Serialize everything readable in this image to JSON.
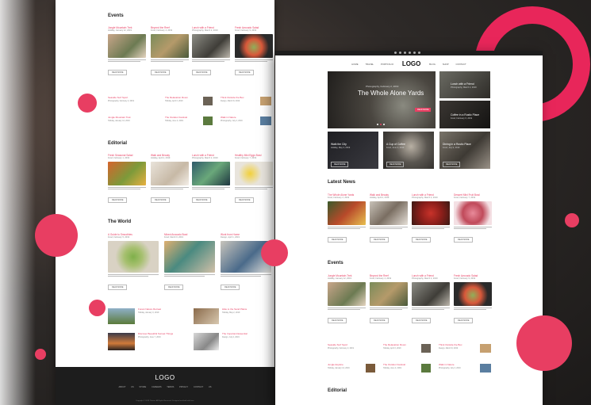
{
  "left": {
    "events_title": "Events",
    "events": [
      {
        "title": "Jungle Mountain Trek",
        "meta": "Holiday, January 12, 2019",
        "btn": "READ MORE"
      },
      {
        "title": "Beyond the Reef",
        "meta": "Food, February 4, 2019",
        "btn": "READ MORE"
      },
      {
        "title": "Lunch with a Friend",
        "meta": "Photography, March 2, 2019",
        "btn": "READ MORE"
      },
      {
        "title": "Fresh Avocado Salad",
        "meta": "Food, February 9, 2019",
        "btn": "READ MORE"
      }
    ],
    "events_mini": [
      {
        "title": "Seaside Surf Sport",
        "meta": "Photography, February 2, 2019"
      },
      {
        "title": "The Relaxation Room",
        "meta": "Holiday, April 3, 2019"
      },
      {
        "title": "Think Outside the Box",
        "meta": "Design, March 8, 2019"
      },
      {
        "title": "Jungle Mountain Trek",
        "meta": "Holiday, January 12, 2019"
      },
      {
        "title": "The Outdoor Festival",
        "meta": "Holiday, June 4, 2019"
      },
      {
        "title": "Walk in Nature",
        "meta": "Photography, July 2, 2019"
      }
    ],
    "editorial_title": "Editorial",
    "editorial": [
      {
        "title": "Fresh Seasonal Salad",
        "meta": "Food, February 1, 2019",
        "btn": "READ MORE"
      },
      {
        "title": "Walk and Beauty",
        "meta": "Holiday, April 2, 2019",
        "btn": "READ MORE"
      },
      {
        "title": "Lunch with a Friend",
        "meta": "Photography, March 2, 2019",
        "btn": "READ MORE"
      },
      {
        "title": "Healthy Mini Eggs Bowl",
        "meta": "Food, February 7, 2019",
        "btn": "READ MORE"
      }
    ],
    "world_title": "The World",
    "world": [
      {
        "title": "A Guide to Smoothies",
        "meta": "Food, February 5, 2019",
        "btn": "READ MORE"
      },
      {
        "title": "Mixed Avocado Bowl",
        "meta": "Food, March 9, 2019",
        "btn": "READ MORE"
      },
      {
        "title": "Work from Home",
        "meta": "Design, April 1, 2019",
        "btn": "READ MORE"
      }
    ],
    "world_mini": [
      {
        "title": "Forest Nature Retreat",
        "meta": "Holiday, January 3, 2019"
      },
      {
        "title": "Hike to the Sand Plains",
        "meta": "Holiday, May 2, 2019"
      },
      {
        "title": "Discover Beautiful Sunset Things",
        "meta": "Photography, June 7, 2019"
      },
      {
        "title": "The Important Essential",
        "meta": "Design, July 2, 2019"
      }
    ],
    "footer": {
      "logo": "LOGO",
      "links": "ABOUT US  STORE  CAREERS  TERMS  PRIVACY  CONTACT US",
      "copy": "Copyright © 2019 Theme. All Rights Reserved. Designed and built with love."
    }
  },
  "right": {
    "nav": {
      "left": [
        "HOME",
        "TRAVEL",
        "PORTFOLIO"
      ],
      "logo": "LOGO",
      "right": [
        "BLOG",
        "SHOP",
        "CONTACT"
      ]
    },
    "hero": {
      "meta": "Photography, February 2, 2019",
      "title": "The Whole Alone Yards",
      "btn": "READ MORE"
    },
    "side_posts": [
      {
        "title": "Lunch with a Friend",
        "meta": "Photography, March 2, 2019"
      },
      {
        "title": "Coffee in a Rustic Place",
        "meta": "Food, February 6, 2019"
      }
    ],
    "strip": [
      {
        "title": "Walk the City",
        "meta": "Holiday, May 3, 2019",
        "btn": "READ MORE"
      },
      {
        "title": "A Cup of Coffee",
        "meta": "Food, June 2, 2019",
        "btn": "READ MORE"
      },
      {
        "title": "Dining in a Rustic Place",
        "meta": "Food, July 9, 2019",
        "btn": "READ MORE"
      }
    ],
    "latest_title": "Latest News",
    "latest": [
      {
        "title": "The Whole Alone Yards",
        "meta": "Food, February 2, 2019",
        "btn": "READ MORE"
      },
      {
        "title": "Walk and Beauty",
        "meta": "Holiday, April 2, 2019",
        "btn": "READ MORE"
      },
      {
        "title": "Lunch with a Friend",
        "meta": "Photography, March 2, 2019",
        "btn": "READ MORE"
      },
      {
        "title": "Dessert Mini Fruit Bowl",
        "meta": "Food, February 7, 2019",
        "btn": "READ MORE"
      }
    ],
    "events_title": "Events",
    "events": [
      {
        "title": "Jungle Mountain Trek",
        "meta": "Holiday, January 12, 2019",
        "btn": "READ MORE"
      },
      {
        "title": "Beyond the Reef",
        "meta": "Food, February 4, 2019",
        "btn": "READ MORE"
      },
      {
        "title": "Lunch with a Friend",
        "meta": "Photography, March 2, 2019",
        "btn": "READ MORE"
      },
      {
        "title": "Fresh Avocado Salad",
        "meta": "Food, February 9, 2019",
        "btn": "READ MORE"
      }
    ],
    "events_mini": [
      {
        "title": "Seaside Surf Sport",
        "meta": "Photography, February 2, 2019"
      },
      {
        "title": "The Relaxation Room",
        "meta": "Holiday, April 3, 2019"
      },
      {
        "title": "Think Outside the Box",
        "meta": "Design, March 8, 2019"
      },
      {
        "title": "Jungle Explore",
        "meta": "Holiday, January 12, 2019"
      },
      {
        "title": "The Outdoor Festival",
        "meta": "Holiday, June 4, 2019"
      },
      {
        "title": "Walk in Nature",
        "meta": "Photography, July 2, 2019"
      }
    ],
    "editorial_title": "Editorial"
  }
}
